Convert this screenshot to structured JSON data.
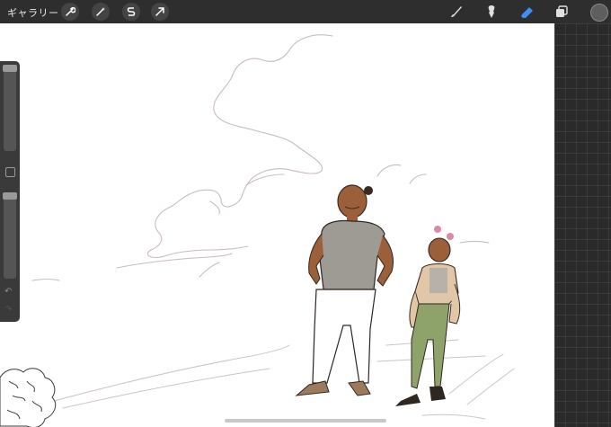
{
  "toolbar": {
    "gallery_label": "ギャラリー",
    "left_tools": [
      "wrench-icon",
      "magic-wand-icon",
      "selection-s-icon",
      "transform-arrow-icon"
    ],
    "right_tools": [
      "brush-icon",
      "smudge-icon",
      "eraser-icon",
      "layers-icon"
    ],
    "active_tool": "eraser-icon",
    "accent_color": "#3f8ef5",
    "current_color": "#5e5e5e"
  },
  "sidebar": {
    "brush_size_level": 0.95,
    "opacity_level": 0.95,
    "icons": [
      "undo-icon",
      "redo-icon"
    ]
  },
  "canvas": {
    "background": "#ffffff",
    "artwork": "sketch-of-two-figures"
  }
}
